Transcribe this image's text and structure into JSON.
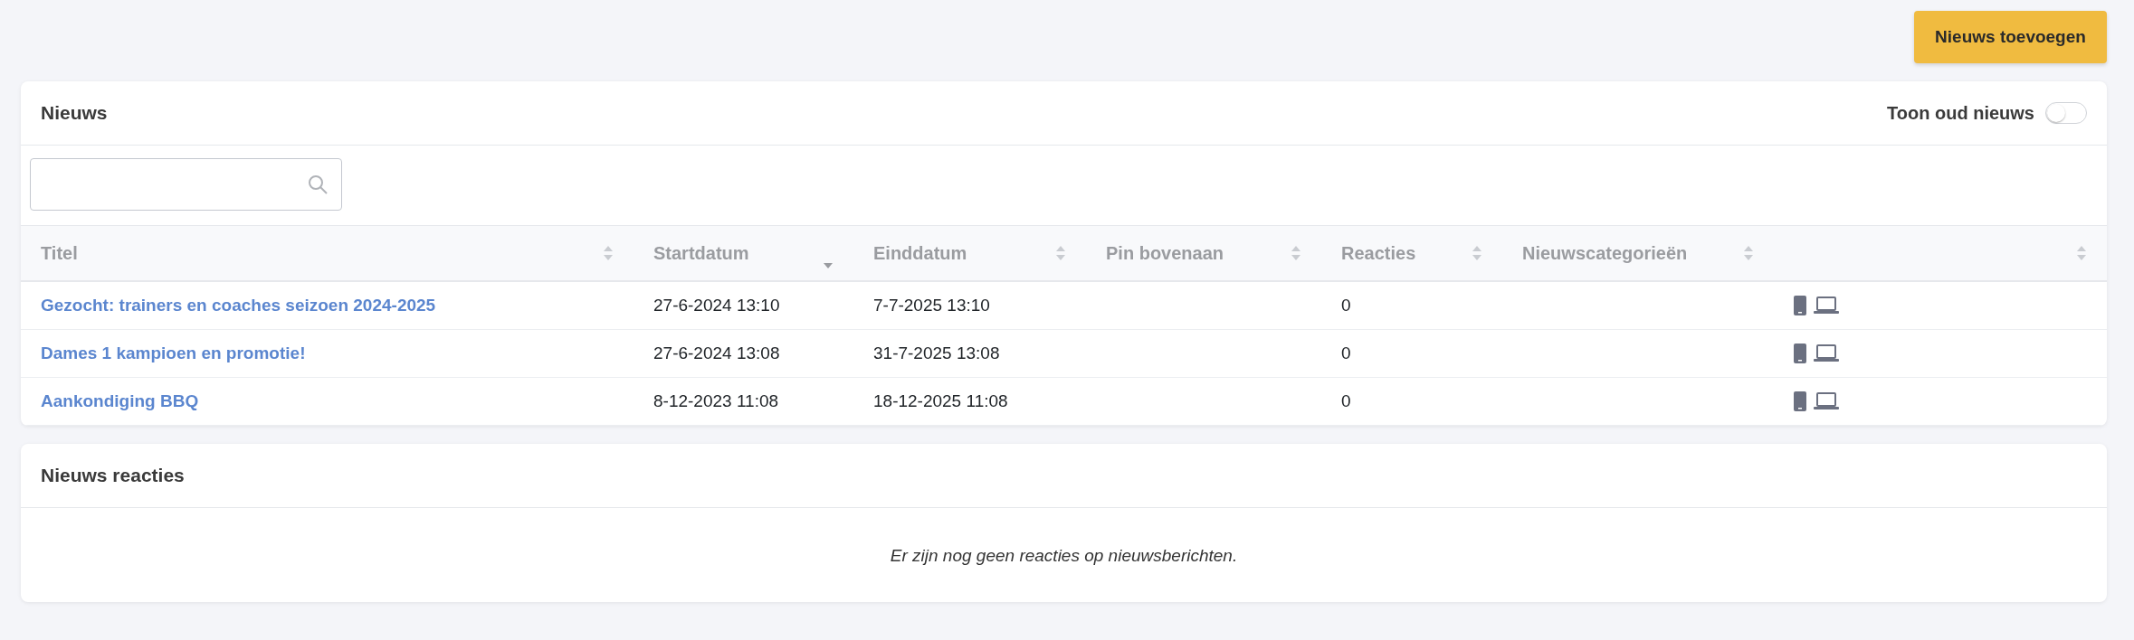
{
  "add_button": "Nieuws toevoegen",
  "news_card": {
    "title": "Nieuws",
    "toggle": {
      "label": "Toon oud nieuws",
      "on": false
    },
    "table": {
      "columns": [
        {
          "label": "Titel",
          "sorted": false
        },
        {
          "label": "Startdatum",
          "sorted": true
        },
        {
          "label": "Einddatum",
          "sorted": false
        },
        {
          "label": "Pin bovenaan",
          "sorted": false
        },
        {
          "label": "Reacties",
          "sorted": false
        },
        {
          "label": "Nieuwscategorieën",
          "sorted": false
        },
        {
          "sorted": false
        }
      ],
      "rows": [
        {
          "title": "Gezocht: trainers en coaches seizoen 2024-2025",
          "start": "27-6-2024 13:10",
          "end": "7-7-2025 13:10",
          "reactions": "0"
        },
        {
          "title": "Dames 1 kampioen en promotie!",
          "start": "27-6-2024 13:08",
          "end": "31-7-2025 13:08",
          "reactions": "0"
        },
        {
          "title": "Aankondiging BBQ",
          "start": "8-12-2023 11:08",
          "end": "18-12-2025 11:08",
          "reactions": "0"
        }
      ]
    }
  },
  "reactions_card": {
    "title": "Nieuws reacties",
    "empty_message": "Er zijn nog geen reacties op nieuwsberichten."
  }
}
